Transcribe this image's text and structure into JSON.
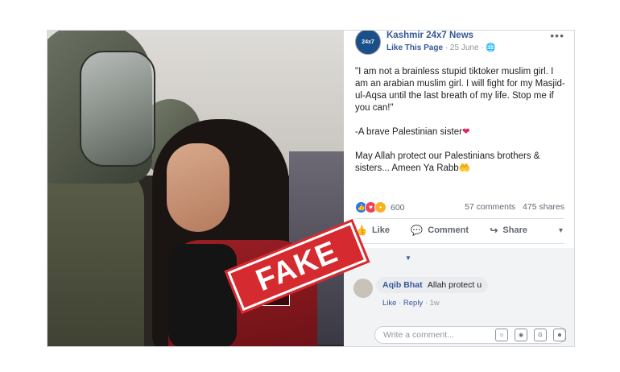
{
  "page": {
    "name": "Kashmir 24x7 News",
    "logo_text": "24x7",
    "like_page": "Like This Page",
    "date": "25 June",
    "menu": "•••"
  },
  "post": {
    "paragraph1": "\"I am not a brainless stupid tiktoker muslim girl. I am an arabian muslim girl. I will fight for my Masjid-ul-Aqsa until the last breath of my life. Stop me if you can!\"",
    "paragraph2": "-A brave Palestinian sister",
    "paragraph2_emoji": "❤",
    "paragraph3": "May Allah protect our Palestinians brothers & sisters... Ameen Ya Rabb",
    "paragraph3_emoji": "🤲"
  },
  "stats": {
    "reactions": "600",
    "comments": "57 comments",
    "shares": "475 shares"
  },
  "actions": {
    "like": "Like",
    "comment": "Comment",
    "share": "Share"
  },
  "comment": {
    "author": "Aqib Bhat",
    "text": "Allah protect u",
    "like": "Like",
    "reply": "Reply",
    "time": "1w"
  },
  "composer": {
    "placeholder": "Write a comment..."
  },
  "stamp": {
    "text": "FAKE"
  },
  "photo": {
    "info_label": "i"
  },
  "colors": {
    "link": "#365899",
    "stamp": "#d52b30",
    "like": "#2078f4",
    "love": "#f33e58"
  }
}
